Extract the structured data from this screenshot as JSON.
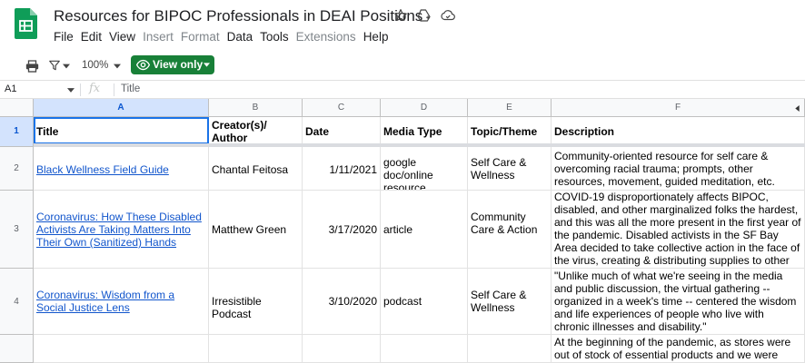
{
  "app": {
    "doc_title": "Resources for BIPOC Professionals in DEAI Positions",
    "menu": [
      {
        "label": "File",
        "disabled": false
      },
      {
        "label": "Edit",
        "disabled": false
      },
      {
        "label": "View",
        "disabled": false
      },
      {
        "label": "Insert",
        "disabled": true
      },
      {
        "label": "Format",
        "disabled": true
      },
      {
        "label": "Data",
        "disabled": false
      },
      {
        "label": "Tools",
        "disabled": false
      },
      {
        "label": "Extensions",
        "disabled": true
      },
      {
        "label": "Help",
        "disabled": false
      }
    ]
  },
  "toolbar": {
    "zoom": "100%",
    "view_only_label": "View only"
  },
  "formula_bar": {
    "cell_ref": "A1",
    "fx": "fx",
    "value": "Title"
  },
  "grid": {
    "columns": [
      "A",
      "B",
      "C",
      "D",
      "E",
      "F"
    ],
    "header_row": {
      "num": "1",
      "cells": [
        "Title",
        "Creator(s)/\nAuthor",
        "Date",
        "Media Type",
        "Topic/Theme",
        "Description"
      ]
    },
    "rows": [
      {
        "num": "2",
        "title": "Black Wellness Field Guide",
        "creator": "Chantal Feitosa",
        "date": "1/11/2021",
        "media": "google doc/online resource",
        "topic": "Self Care & Wellness",
        "description": "Community-oriented resource for self care & overcoming racial trauma; prompts, other resources, movement, guided meditation, etc."
      },
      {
        "num": "3",
        "title": "Coronavirus: How These Disabled Activists Are Taking Matters Into Their Own (Sanitized) Hands",
        "creator": "Matthew Green",
        "date": "3/17/2020",
        "media": "article",
        "topic": "Community Care & Action",
        "description": "COVID-19 disproportionately affects BIPOC, disabled, and other marginalized folks the hardest, and this was all the more present in the first year of the pandemic. Disabled activists in the SF Bay Area decided to take collective action in the face of the virus, creating & distributing supplies to other marginalized folks."
      },
      {
        "num": "4",
        "title": "Coronavirus: Wisdom from a Social Justice Lens",
        "creator": "Irresistible Podcast",
        "date": "3/10/2020",
        "media": "podcast",
        "topic": "Self Care & Wellness",
        "description": "\"Unlike much of what we're seeing in the media and public discussion, the virtual gathering -- organized in a week's time --  centered the wisdom and life experiences of people who live with chronic illnesses and disability.\""
      },
      {
        "num": "",
        "title": "",
        "creator": "",
        "date": "",
        "media": "",
        "topic": "",
        "description": "At the beginning of the pandemic, as stores were out of stock of essential products and we were advised to"
      }
    ]
  }
}
